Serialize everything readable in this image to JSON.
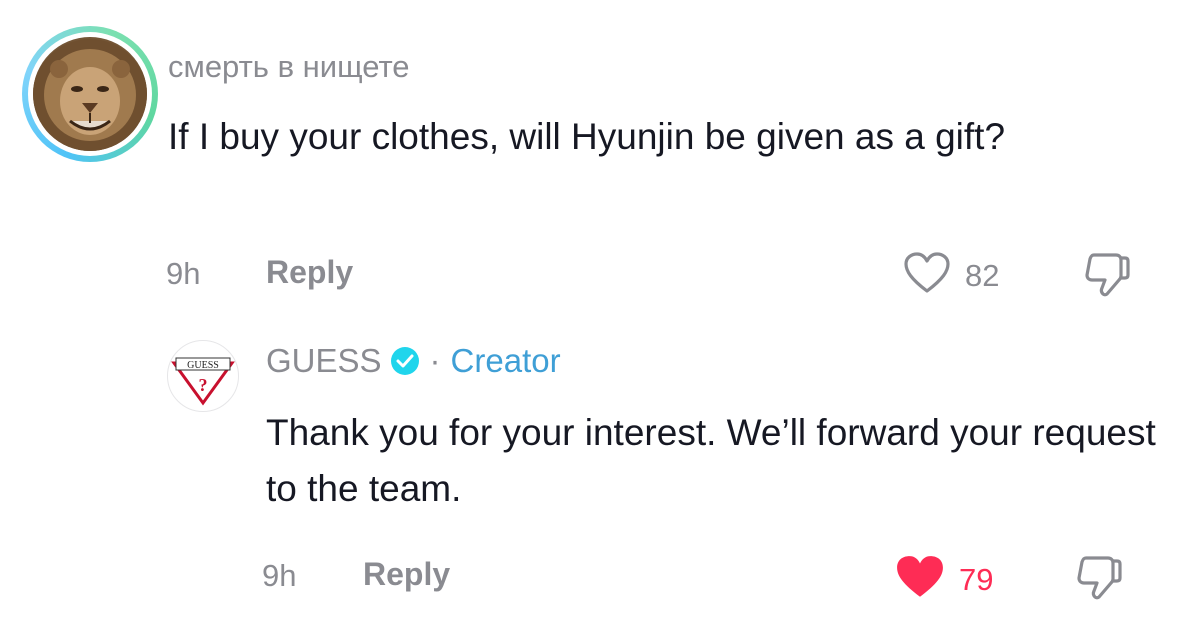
{
  "comments": [
    {
      "username": "смерть в нищете",
      "text": "If I buy your clothes, will Hyunjin be given as a gift?",
      "time": "9h",
      "reply_label": "Reply",
      "likes": "82",
      "liked": false,
      "avatar_icon": "lion-avatar"
    },
    {
      "username": "GUESS",
      "verified": true,
      "separator": "·",
      "role_label": "Creator",
      "text": "Thank you for your interest. We’ll forward your request to the team.",
      "time": "9h",
      "reply_label": "Reply",
      "likes": "79",
      "liked": true,
      "avatar_icon": "guess-logo",
      "avatar_text": "GUESS"
    }
  ],
  "colors": {
    "muted": "#8a8b91",
    "text": "#161823",
    "liked_red": "#fe2c55",
    "creator_blue": "#3f9fd6",
    "verified_blue": "#20d5ec"
  }
}
